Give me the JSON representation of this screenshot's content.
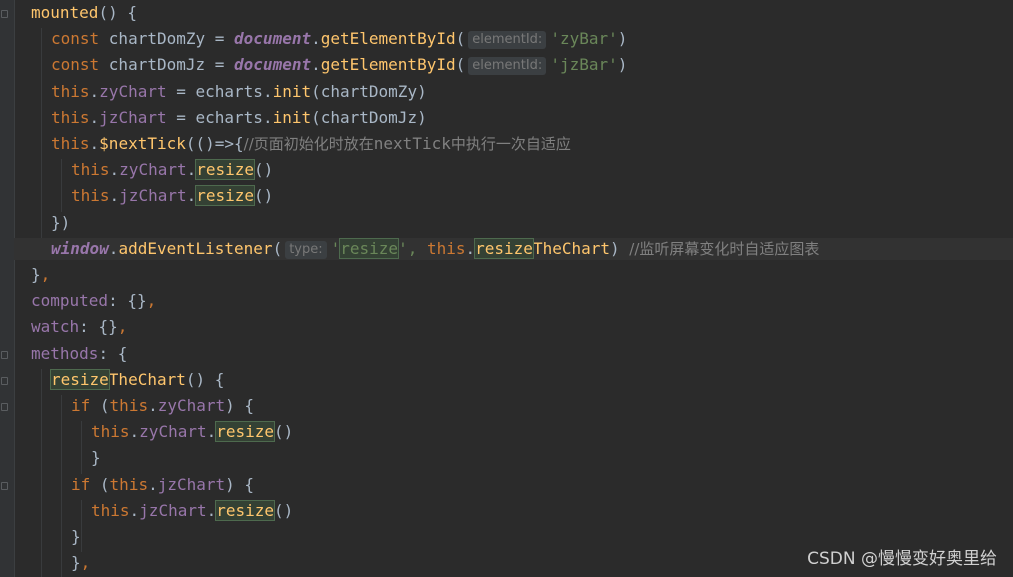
{
  "editor": {
    "lines": [
      {
        "indent": 0,
        "tokens": [
          {
            "t": "mounted",
            "c": "fn"
          },
          {
            "t": "() {"
          }
        ]
      },
      {
        "indent": 1,
        "tokens": [
          {
            "t": "const ",
            "c": "kw"
          },
          {
            "t": "chartDomZy = "
          },
          {
            "t": "document",
            "c": "glob"
          },
          {
            "t": "."
          },
          {
            "t": "getElementById",
            "c": "fn"
          },
          {
            "t": "("
          },
          {
            "hint": "elementId:"
          },
          {
            "t": "'zyBar'",
            "c": "str"
          },
          {
            "t": ")"
          }
        ]
      },
      {
        "indent": 1,
        "tokens": [
          {
            "t": "const ",
            "c": "kw"
          },
          {
            "t": "chartDomJz = "
          },
          {
            "t": "document",
            "c": "glob"
          },
          {
            "t": "."
          },
          {
            "t": "getElementById",
            "c": "fn"
          },
          {
            "t": "("
          },
          {
            "hint": "elementId:"
          },
          {
            "t": "'jzBar'",
            "c": "str"
          },
          {
            "t": ")"
          }
        ]
      },
      {
        "indent": 1,
        "tokens": [
          {
            "t": "this",
            "c": "kw"
          },
          {
            "t": "."
          },
          {
            "t": "zyChart",
            "c": "prop"
          },
          {
            "t": " = echarts."
          },
          {
            "t": "init",
            "c": "fn"
          },
          {
            "t": "(chartDomZy)"
          }
        ]
      },
      {
        "indent": 1,
        "tokens": [
          {
            "t": "this",
            "c": "kw"
          },
          {
            "t": "."
          },
          {
            "t": "jzChart",
            "c": "prop"
          },
          {
            "t": " = echarts."
          },
          {
            "t": "init",
            "c": "fn"
          },
          {
            "t": "(chartDomJz)"
          }
        ]
      },
      {
        "indent": 1,
        "tokens": [
          {
            "t": "this",
            "c": "kw"
          },
          {
            "t": "."
          },
          {
            "t": "$nextTick",
            "c": "fn"
          },
          {
            "t": "(()=>{"
          },
          {
            "t": "//页面初始化时放在",
            "c": "cmt"
          },
          {
            "t": "nextTick",
            "c": "cmt-code"
          },
          {
            "t": "中执行一次自适应",
            "c": "cmt"
          }
        ]
      },
      {
        "indent": 2,
        "tokens": [
          {
            "t": "this",
            "c": "kw"
          },
          {
            "t": "."
          },
          {
            "t": "zyChart",
            "c": "prop"
          },
          {
            "t": "."
          },
          {
            "t": "resize",
            "c": "hl"
          },
          {
            "t": "()"
          }
        ]
      },
      {
        "indent": 2,
        "tokens": [
          {
            "t": "this",
            "c": "kw"
          },
          {
            "t": "."
          },
          {
            "t": "jzChart",
            "c": "prop"
          },
          {
            "t": "."
          },
          {
            "t": "resize",
            "c": "hl"
          },
          {
            "t": "()"
          }
        ]
      },
      {
        "indent": 1,
        "tokens": [
          {
            "t": "})"
          }
        ]
      },
      {
        "indent": 1,
        "current": true,
        "tokens": [
          {
            "t": "window",
            "c": "glob"
          },
          {
            "t": "."
          },
          {
            "t": "addEventListener",
            "c": "fn"
          },
          {
            "t": "("
          },
          {
            "hint": "type:"
          },
          {
            "t": "'",
            "c": "str"
          },
          {
            "t": "resize",
            "c": "hl-str"
          },
          {
            "t": "', ",
            "c": "str"
          },
          {
            "t": "this",
            "c": "kw"
          },
          {
            "t": "."
          },
          {
            "t": "resize",
            "c": "hl"
          },
          {
            "t": "TheChart",
            "c": "fn"
          },
          {
            "t": ") "
          },
          {
            "t": "//监听屏幕变化时自适应图表",
            "c": "cmt"
          }
        ]
      },
      {
        "indent": 0,
        "tokens": [
          {
            "t": "}"
          },
          {
            "t": ",",
            "c": "kw"
          }
        ]
      },
      {
        "indent": 0,
        "tokens": [
          {
            "t": "computed",
            "c": "prop"
          },
          {
            "t": ": {}"
          },
          {
            "t": ",",
            "c": "kw"
          }
        ]
      },
      {
        "indent": 0,
        "tokens": [
          {
            "t": "watch",
            "c": "prop"
          },
          {
            "t": ": {}"
          },
          {
            "t": ",",
            "c": "kw"
          }
        ]
      },
      {
        "indent": 0,
        "tokens": [
          {
            "t": "methods",
            "c": "prop"
          },
          {
            "t": ": {"
          }
        ]
      },
      {
        "indent": 1,
        "tokens": [
          {
            "t": "resize",
            "c": "hl"
          },
          {
            "t": "TheChart",
            "c": "fn"
          },
          {
            "t": "() {"
          }
        ]
      },
      {
        "indent": 2,
        "tokens": [
          {
            "t": "if ",
            "c": "kw"
          },
          {
            "t": "("
          },
          {
            "t": "this",
            "c": "kw"
          },
          {
            "t": "."
          },
          {
            "t": "zyChart",
            "c": "prop"
          },
          {
            "t": ") {"
          }
        ]
      },
      {
        "indent": 3,
        "tokens": [
          {
            "t": "this",
            "c": "kw"
          },
          {
            "t": "."
          },
          {
            "t": "zyChart",
            "c": "prop"
          },
          {
            "t": "."
          },
          {
            "t": "resize",
            "c": "hl"
          },
          {
            "t": "()"
          }
        ]
      },
      {
        "indent": 3,
        "tokens": [
          {
            "t": "}"
          }
        ]
      },
      {
        "indent": 2,
        "tokens": [
          {
            "t": "if ",
            "c": "kw"
          },
          {
            "t": "("
          },
          {
            "t": "this",
            "c": "kw"
          },
          {
            "t": "."
          },
          {
            "t": "jzChart",
            "c": "prop"
          },
          {
            "t": ") {"
          }
        ]
      },
      {
        "indent": 3,
        "tokens": [
          {
            "t": "this",
            "c": "kw"
          },
          {
            "t": "."
          },
          {
            "t": "jzChart",
            "c": "prop"
          },
          {
            "t": "."
          },
          {
            "t": "resize",
            "c": "hl"
          },
          {
            "t": "()"
          }
        ]
      },
      {
        "indent": 2,
        "tokens": [
          {
            "t": "}"
          }
        ]
      },
      {
        "indent": 2,
        "tokens": [
          {
            "t": "}"
          },
          {
            "t": ",",
            "c": "kw"
          }
        ]
      }
    ]
  },
  "watermark": "CSDN @慢慢变好奥里给",
  "colors": {
    "background": "#2b2b2b",
    "keyword": "#cc7832",
    "function": "#ffc66d",
    "property": "#9876aa",
    "string": "#6a8759",
    "comment": "#808080",
    "default_text": "#a9b7c6"
  }
}
